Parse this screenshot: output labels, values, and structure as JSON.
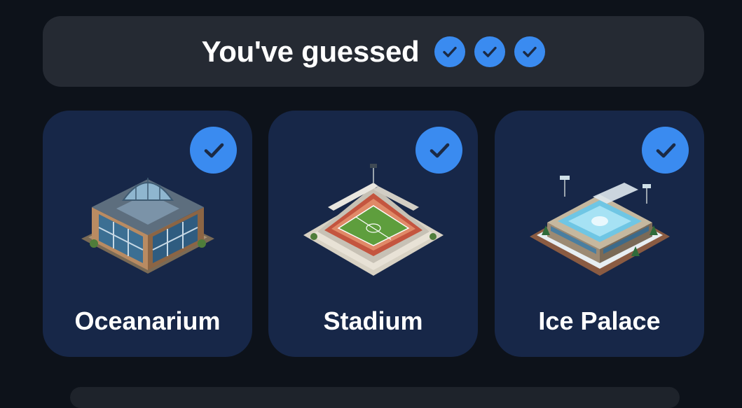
{
  "banner": {
    "title": "You've guessed",
    "check_count": 3,
    "check_icon": "check-circle-icon"
  },
  "cards": [
    {
      "label": "Oceanarium",
      "icon": "oceanarium-building-icon",
      "guessed": true
    },
    {
      "label": "Stadium",
      "icon": "stadium-building-icon",
      "guessed": true
    },
    {
      "label": "Ice Palace",
      "icon": "ice-palace-building-icon",
      "guessed": true
    }
  ],
  "colors": {
    "background": "#0d121a",
    "banner": "#252a33",
    "card": "#172748",
    "check": "#3a8bf0",
    "text": "#ffffff"
  }
}
